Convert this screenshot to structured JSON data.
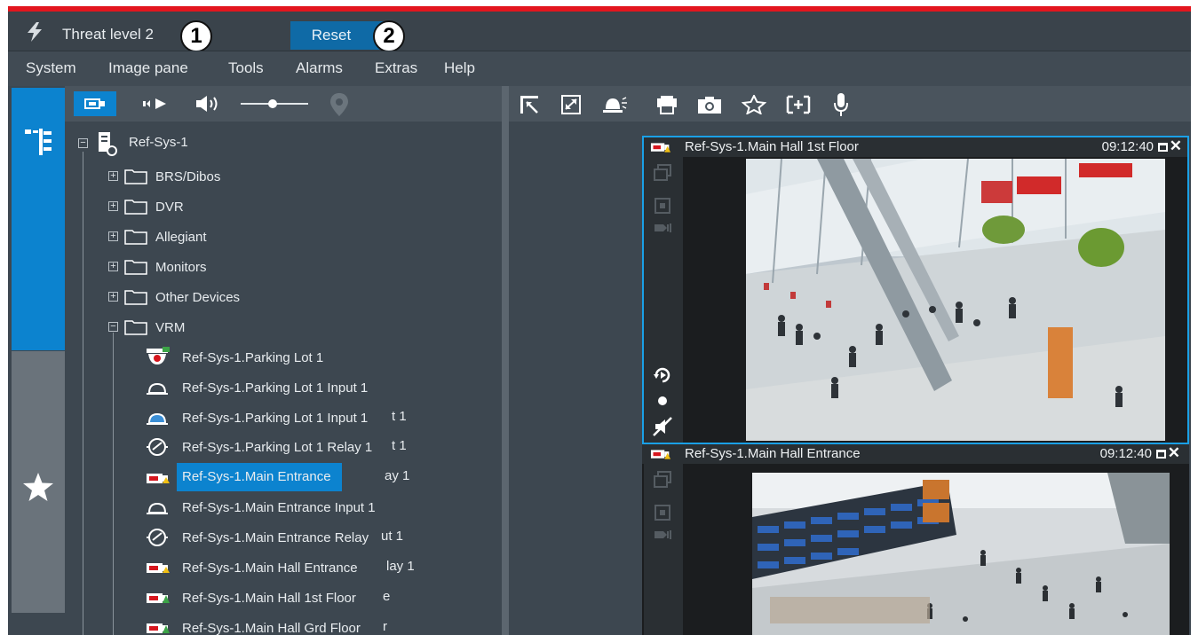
{
  "window": {
    "threat_label": "Threat level 2",
    "reset_label": "Reset",
    "callouts": [
      "1",
      "2"
    ],
    "accent_red": "#e3161e",
    "accent_blue": "#0c83cf"
  },
  "menu": [
    "System",
    "Image pane",
    "Tools",
    "Alarms",
    "Extras",
    "Help"
  ],
  "tree": {
    "root": "Ref-Sys-1",
    "folders": [
      "BRS/Dibos",
      "DVR",
      "Allegiant",
      "Monitors",
      "Other Devices",
      "VRM"
    ],
    "devices": [
      {
        "label": "Ref-Sys-1.Parking Lot 1",
        "icon": "camera-dome-icon",
        "ghost": ""
      },
      {
        "label": "Ref-Sys-1.Parking Lot 1 Input 1",
        "icon": "input-icon",
        "ghost": ""
      },
      {
        "label": "Ref-Sys-1.Parking Lot 1 Input 1",
        "icon": "input-icon",
        "ghost": "t 1"
      },
      {
        "label": "Ref-Sys-1.Parking Lot 1 Relay 1",
        "icon": "relay-icon",
        "ghost": "t 1"
      },
      {
        "label": "Ref-Sys-1.Main Entrance",
        "icon": "camera-icon",
        "ghost": "ay 1",
        "selected": true
      },
      {
        "label": "Ref-Sys-1.Main Entrance Input 1",
        "icon": "input-icon",
        "ghost": ""
      },
      {
        "label": "Ref-Sys-1.Main Entrance Relay",
        "icon": "relay-icon",
        "ghost": "ut 1"
      },
      {
        "label": "Ref-Sys-1.Main Hall Entrance",
        "icon": "camera-icon",
        "ghost": "lay 1"
      },
      {
        "label": "Ref-Sys-1.Main Hall 1st Floor",
        "icon": "camera-icon",
        "ghost": "e"
      },
      {
        "label": "Ref-Sys-1.Main Hall Grd Floor",
        "icon": "camera-icon",
        "ghost": "r"
      }
    ]
  },
  "panes": [
    {
      "title": "Ref-Sys-1.Main Hall 1st Floor",
      "time": "09:12:40",
      "scene": "airport-hall-video"
    },
    {
      "title": "Ref-Sys-1.Main Hall Entrance",
      "time": "09:12:40",
      "scene": "departure-board-video"
    }
  ],
  "tree_toolbar_icons": [
    "live-mode-icon",
    "playback-icon",
    "volume-icon",
    "volume-slider",
    "pin-icon"
  ],
  "pane_toolbar_icons": [
    "restore-icon",
    "fullscreen-icon",
    "alarm-icon",
    "print-icon",
    "snapshot-icon",
    "favorite-icon",
    "zoom-icon",
    "microphone-icon"
  ]
}
